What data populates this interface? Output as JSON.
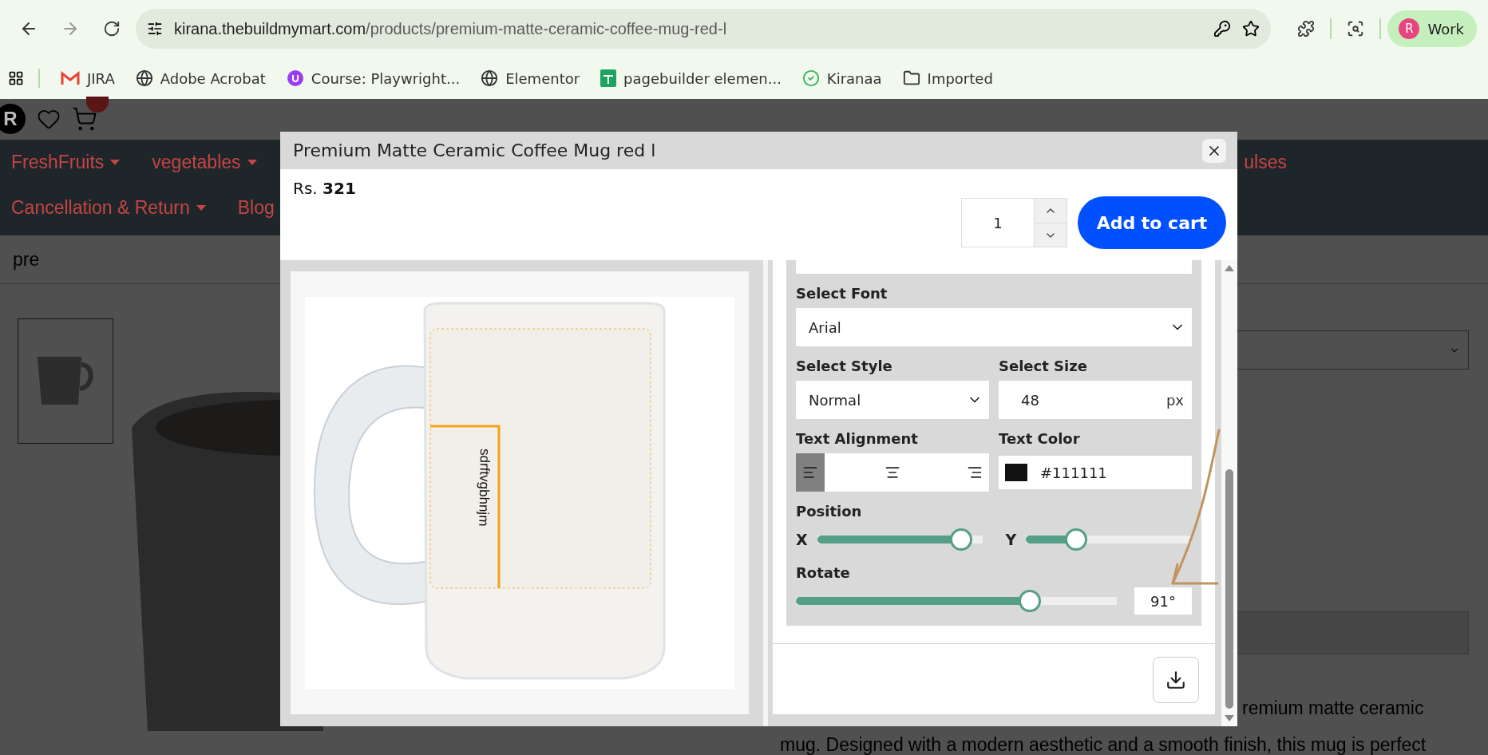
{
  "browser": {
    "url_host": "kirana.thebuildmymart.com",
    "url_path": "/products/premium-matte-ceramic-coffee-mug-red-l",
    "profile_initial": "R",
    "profile_label": "Work"
  },
  "bookmarks": [
    {
      "label": "JIRA"
    },
    {
      "label": "Adobe Acrobat"
    },
    {
      "label": "Course: Playwright..."
    },
    {
      "label": "Elementor"
    },
    {
      "label": "pagebuilder elemen..."
    },
    {
      "label": "Kiranaa"
    },
    {
      "label": "Imported"
    }
  ],
  "site": {
    "avatar": "R",
    "nav_row_1": [
      {
        "label": "FreshFruits",
        "has_menu": true
      },
      {
        "label": "vegetables",
        "has_menu": true
      }
    ],
    "nav_end": "ulses",
    "nav_row_2": [
      {
        "label": "Cancellation & Return",
        "has_menu": true
      },
      {
        "label": "Blog",
        "has_menu": false
      }
    ],
    "search_text": "pre",
    "description_lines": [
      "remium matte ceramic",
      "mug. Designed with a modern aesthetic and a smooth finish, this mug is perfect"
    ]
  },
  "modal": {
    "title": "Premium Matte Ceramic Coffee Mug red l",
    "price_label": "Rs.",
    "price": "321",
    "quantity": "1",
    "add_to_cart": "Add to cart",
    "design_text": "sdrftvgbhnjm",
    "font": {
      "label": "Select Font",
      "value": "Arial"
    },
    "style": {
      "label": "Select Style",
      "value": "Normal"
    },
    "size": {
      "label": "Select Size",
      "value": "48",
      "unit": "px"
    },
    "alignment": {
      "label": "Text Alignment",
      "options": [
        {
          "kind": "left",
          "selected": true
        },
        {
          "kind": "center",
          "selected": false
        },
        {
          "kind": "right",
          "selected": false
        }
      ]
    },
    "text_color": {
      "label": "Text Color",
      "value": "#111111"
    },
    "position": {
      "label": "Position",
      "x": {
        "label": "X",
        "level": 0.87
      },
      "y": {
        "label": "Y",
        "level": 0.3
      }
    },
    "rotate": {
      "label": "Rotate",
      "level": 0.73,
      "reading": "91°"
    }
  }
}
